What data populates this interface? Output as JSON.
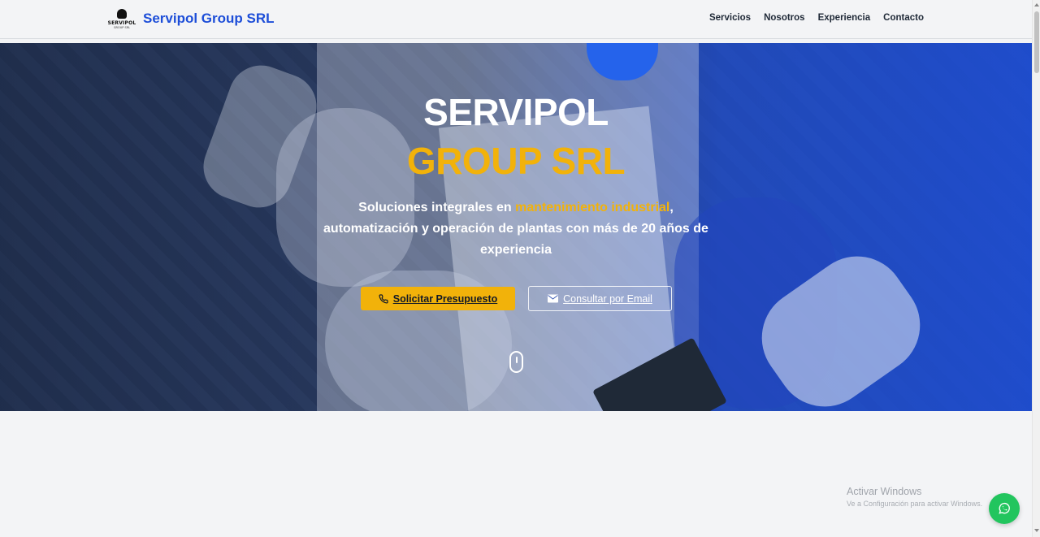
{
  "header": {
    "logo": {
      "text": "SERVIPOL",
      "sub": "GROUP SRL"
    },
    "brand_name": "Servipol Group SRL",
    "nav": [
      {
        "label": "Servicios"
      },
      {
        "label": "Nosotros"
      },
      {
        "label": "Experiencia"
      },
      {
        "label": "Contacto"
      }
    ]
  },
  "hero": {
    "title_line1": "SERVIPOL",
    "title_line2": "GROUP SRL",
    "subtitle_before": "Soluciones integrales en ",
    "subtitle_highlight": "mantenimiento industrial",
    "subtitle_after": ", automatización y operación de plantas con más de 20 años de experiencia",
    "primary_button": "Solicitar Presupuesto",
    "secondary_button": "Consultar por Email",
    "colors": {
      "accent": "#f2b20a",
      "brand": "#1d4ed8",
      "overlay": "#1d4ed8"
    }
  },
  "watermark": {
    "title": "Activar Windows",
    "subtitle": "Ve a Configuración para activar Windows."
  },
  "whatsapp": {
    "icon": "whatsapp-icon",
    "color": "#22c55e"
  }
}
